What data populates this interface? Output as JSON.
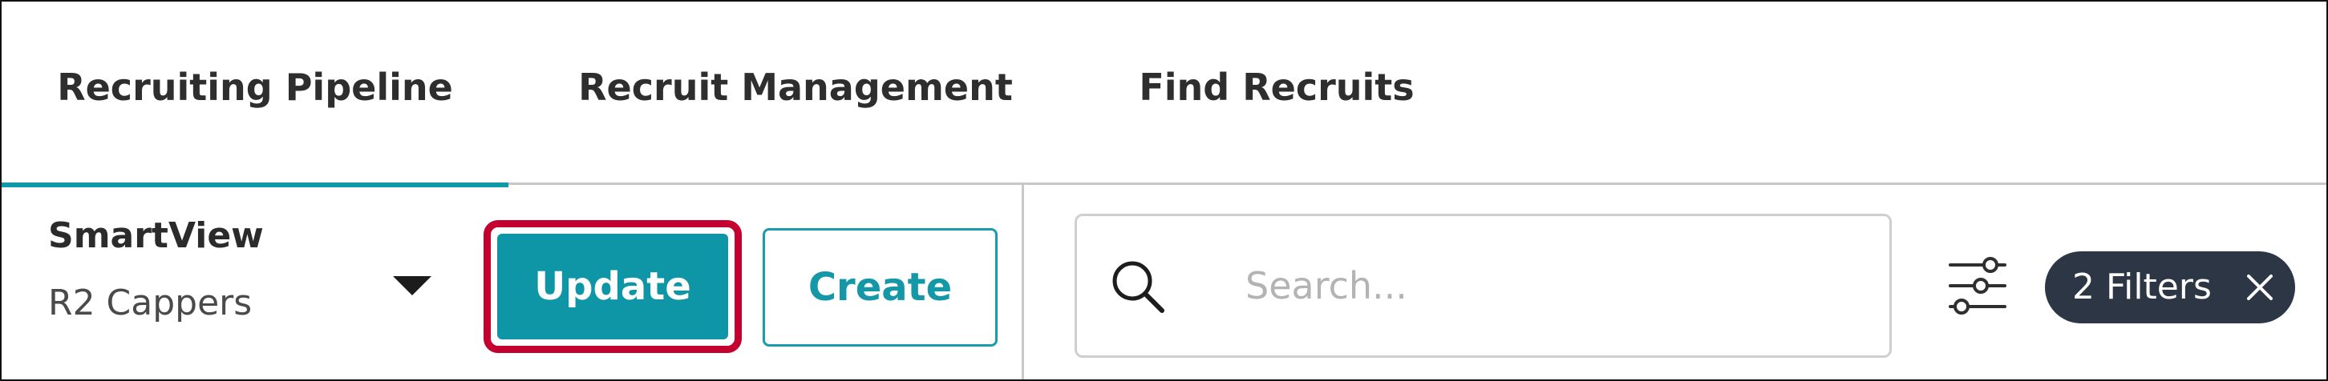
{
  "tabs": [
    {
      "label": "Recruiting Pipeline",
      "active": true
    },
    {
      "label": "Recruit Management",
      "active": false
    },
    {
      "label": "Find Recruits",
      "active": false
    }
  ],
  "toolbar": {
    "smartview": {
      "label": "SmartView",
      "selected": "R2 Cappers",
      "icon": "caret-down-icon"
    },
    "update_label": "Update",
    "create_label": "Create",
    "search": {
      "placeholder": "Search...",
      "value": "",
      "icon": "search-icon"
    },
    "filter_settings_icon": "sliders-icon",
    "filter_chip": {
      "label": "2 Filters",
      "close_icon": "close-icon"
    }
  },
  "colors": {
    "accent": "#0f96a6",
    "highlight": "#c4002f",
    "chip_bg": "#2d3645",
    "divider": "#c9c9c9"
  }
}
